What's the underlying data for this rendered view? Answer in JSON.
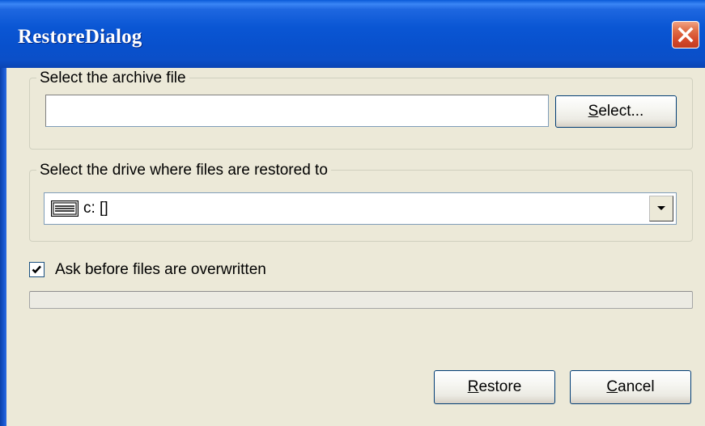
{
  "window": {
    "title": "RestoreDialog"
  },
  "archive_group": {
    "label": "Select the archive file",
    "input_value": "",
    "select_button": {
      "mnemonic": "S",
      "rest": "elect..."
    }
  },
  "drive_group": {
    "label": "Select the drive where files are restored to",
    "selected_value": "c: []",
    "icon": "drive-icon"
  },
  "overwrite_option": {
    "label": "Ask before files are overwritten",
    "checked": true
  },
  "progress": {
    "value": 0
  },
  "buttons": {
    "restore": {
      "mnemonic": "R",
      "rest": "estore"
    },
    "cancel": {
      "mnemonic": "C",
      "rest": "ancel"
    }
  },
  "colors": {
    "titlebar": "#0a56d4",
    "close_button": "#d4492a",
    "dialog_background": "#ece9d8",
    "progress_fill": "#3cb34a"
  }
}
